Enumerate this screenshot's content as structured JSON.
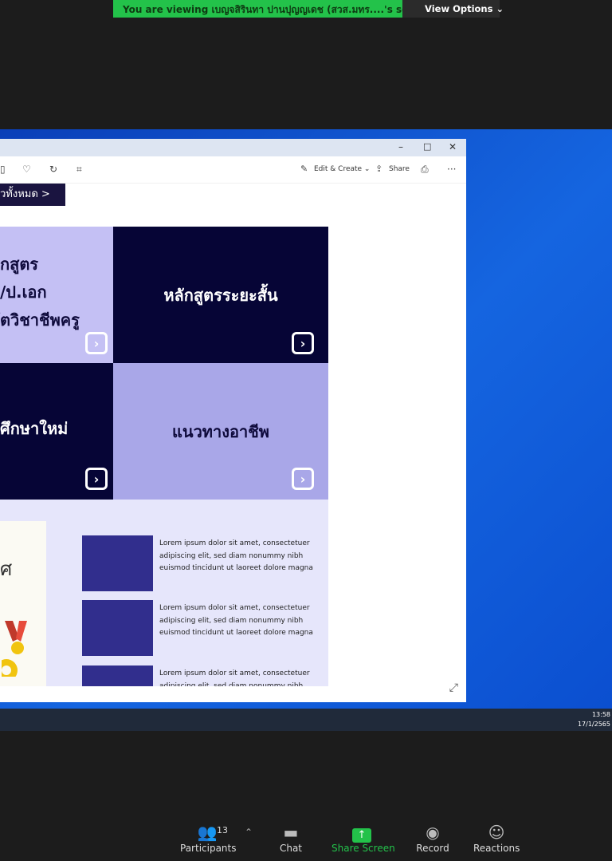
{
  "banner": {
    "viewing_text": "You are viewing เบญจสิรินทา ปานปุญญเดช (สวส.มทร....'s screen",
    "view_options": "View Options ⌄"
  },
  "window": {
    "controls": {
      "minimize": "–",
      "maximize": "□",
      "close": "✕"
    },
    "toolbar": {
      "edit_create": "Edit & Create ⌄",
      "share": "Share",
      "more": "···"
    }
  },
  "image": {
    "all_button": "วทั้งหมด >",
    "tiles": [
      {
        "lines": [
          "กสูตร",
          "/ป.เอก",
          "ัตวิชาชีพครู"
        ],
        "arrow": "›"
      },
      {
        "label": "หลักสูตรระยะสั้น",
        "arrow": "›"
      },
      {
        "label": "ศึกษาใหม่",
        "arrow": "›"
      },
      {
        "label": "แนวทางอาชีพ",
        "arrow": "›"
      }
    ],
    "card_letter": "ศ",
    "items": [
      {
        "text": "Lorem ipsum dolor sit amet, consectetuer adipiscing elit, sed diam nonummy nibh euismod tincidunt ut laoreet dolore magna"
      },
      {
        "text": "Lorem ipsum dolor sit amet, consectetuer adipiscing elit, sed diam nonummy nibh euismod tincidunt ut laoreet dolore magna"
      },
      {
        "text": "Lorem ipsum dolor sit amet, consectetuer adipiscing elit, sed diam nonummy nibh"
      }
    ]
  },
  "taskbar": {
    "time": "13:58",
    "date": "17/1/2565"
  },
  "zoom_bar": {
    "participants": {
      "label": "Participants",
      "count": "13"
    },
    "chat": {
      "label": "Chat"
    },
    "share_screen": {
      "label": "Share Screen"
    },
    "record": {
      "label": "Record"
    },
    "reactions": {
      "label": "Reactions"
    }
  },
  "colors": {
    "banner_green": "#23c24a",
    "tile_dark": "#060536",
    "tile_light": "#c4c0f4",
    "tile_mid": "#a9a7e8",
    "item_square": "#312e8d"
  }
}
